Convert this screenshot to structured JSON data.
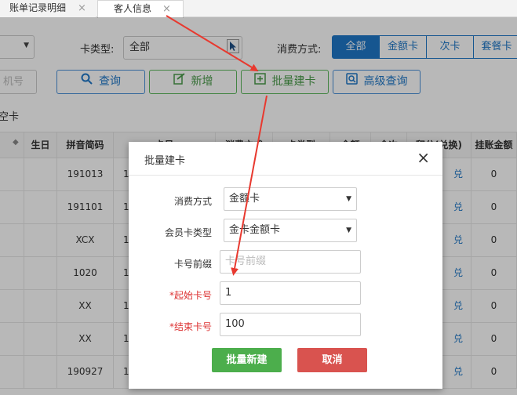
{
  "tabs": [
    {
      "label": "账单记录明细",
      "close": "×"
    },
    {
      "label": "客人信息",
      "close": "×"
    }
  ],
  "filters": {
    "card_type_label": "卡类型:",
    "card_type_value": "全部",
    "consume_label": "消费方式:",
    "consume_options": [
      "全部",
      "金额卡",
      "次卡",
      "套餐卡"
    ],
    "consume_selected": "全部"
  },
  "actions": {
    "left_input_placeholder": "机号",
    "query": "查询",
    "add": "新增",
    "batch": "批量建卡",
    "advanced": "高级查询"
  },
  "section_label": "空卡",
  "table": {
    "headers": [
      "生日",
      "拼音简码",
      "卡号",
      "消费方式",
      "卡类型",
      "余额",
      "余次",
      "积分(兑换)",
      "挂账金额"
    ],
    "rows": [
      {
        "pinyin": "191013",
        "card": "1",
        "exchange": "兑",
        "credit": "0"
      },
      {
        "pinyin": "191101",
        "card": "1",
        "exchange": "兑",
        "credit": "0"
      },
      {
        "pinyin": "XCX",
        "card": "1",
        "exchange": "兑",
        "credit": "0"
      },
      {
        "pinyin": "1020",
        "card": "1",
        "exchange": "兑",
        "credit": "0"
      },
      {
        "pinyin": "XX",
        "card": "1",
        "exchange": "兑",
        "credit": "0"
      },
      {
        "pinyin": "XX",
        "card": "1",
        "exchange": "兑",
        "credit": "0"
      },
      {
        "pinyin": "190927",
        "card": "1",
        "exchange": "兑",
        "credit": "0"
      }
    ]
  },
  "modal": {
    "title": "批量建卡",
    "close": "×",
    "fields": {
      "consume_label": "消费方式",
      "consume_value": "金额卡",
      "member_type_label": "会员卡类型",
      "member_type_value": "金卡金额卡",
      "prefix_label": "卡号前缀",
      "prefix_placeholder": "卡号前缀",
      "start_label": "*起始卡号",
      "start_value": "1",
      "end_label": "*结束卡号",
      "end_value": "100"
    },
    "ok": "批量新建",
    "cancel": "取消"
  },
  "colors": {
    "primary": "#1f78c8",
    "success": "#4cae4c",
    "danger": "#d9534f",
    "annotation": "#e8392f"
  }
}
